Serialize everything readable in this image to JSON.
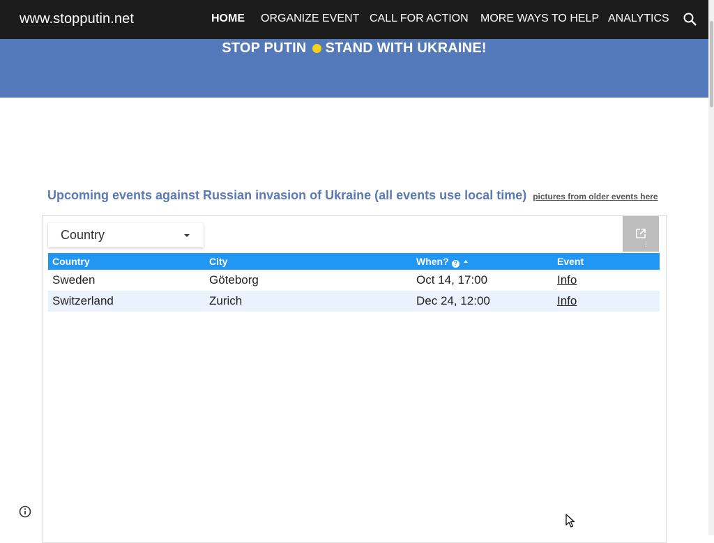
{
  "header": {
    "site_title": "www.stopputin.net",
    "nav": [
      {
        "label": "HOME",
        "active": true
      },
      {
        "label": "ORGANIZE EVENT",
        "active": false
      },
      {
        "label": "CALL FOR ACTION",
        "active": false
      },
      {
        "label": "MORE WAYS TO HELP",
        "active": false
      },
      {
        "label": "ANALYTICS",
        "active": false
      }
    ],
    "search_icon": "search-icon"
  },
  "banner": {
    "left_text": "STOP PUTIN",
    "right_text": "STAND WITH UKRAINE!",
    "dot_color": "#f7d117",
    "background": "#5479bb"
  },
  "main": {
    "heading": "Upcoming events against Russian invasion of Ukraine (all events use local time)",
    "heading_link": "pictures from older events here"
  },
  "table_widget": {
    "filter_label": "Country",
    "open_icon": "open-in-new-icon",
    "header_color": "#2196f3",
    "columns": [
      "Country",
      "City",
      "When?",
      "Event"
    ],
    "rows": [
      {
        "country": "Sweden",
        "city": "Göteborg",
        "when": "Oct 14, 17:00",
        "event": "Info"
      },
      {
        "country": "Switzerland",
        "city": "Zurich",
        "when": "Dec 24, 12:00",
        "event": "Info"
      }
    ]
  },
  "footer": {
    "info_icon": "info-icon"
  }
}
